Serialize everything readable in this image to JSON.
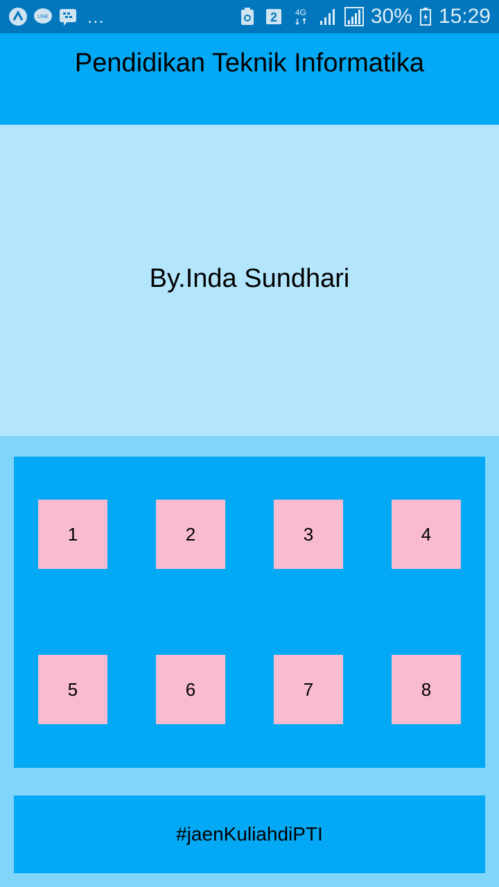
{
  "status_bar": {
    "left_icons": [
      "a-app-icon",
      "line-icon",
      "bbm-icon"
    ],
    "more": "...",
    "network": "4G",
    "sim_label": "2",
    "battery": "30%",
    "time": "15:29"
  },
  "app_bar": {
    "title": "Pendidikan Teknik Informatika"
  },
  "hero": {
    "text": "By.Inda Sundhari"
  },
  "grid": {
    "tiles": [
      "1",
      "2",
      "3",
      "4",
      "5",
      "6",
      "7",
      "8"
    ]
  },
  "footer": {
    "text": "#jaenKuliahdiPTI"
  },
  "colors": {
    "status_bar": "#0277bd",
    "app_bar": "#03a9f4",
    "hero": "#b3e5fc",
    "background": "#81d4fa",
    "tile": "#f8bbd0"
  }
}
